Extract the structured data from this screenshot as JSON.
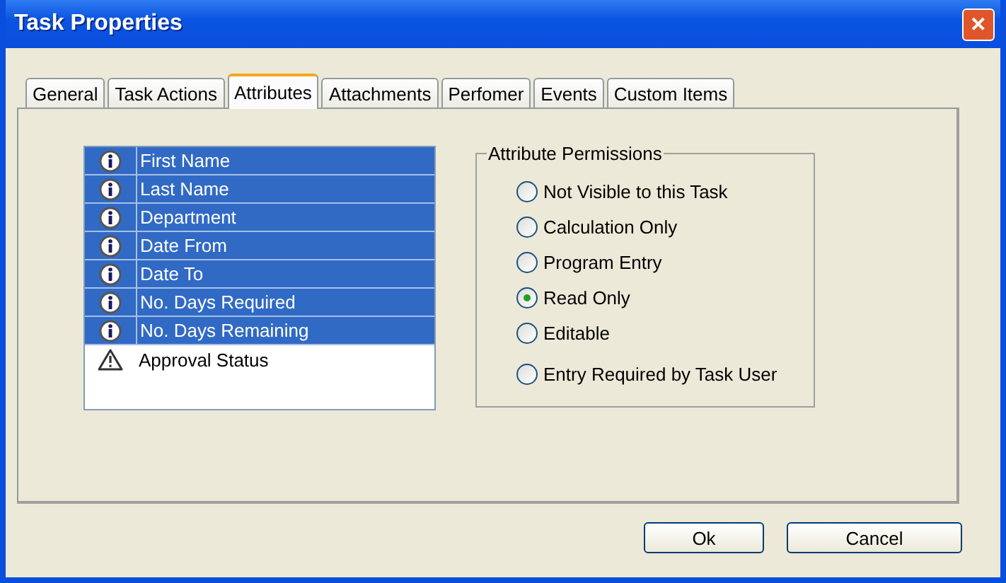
{
  "window": {
    "title": "Task Properties",
    "close": "✕"
  },
  "tabs": [
    {
      "label": "General",
      "selected": false
    },
    {
      "label": "Task Actions",
      "selected": false
    },
    {
      "label": "Attributes",
      "selected": true
    },
    {
      "label": "Attachments",
      "selected": false
    },
    {
      "label": "Perfomer",
      "selected": false
    },
    {
      "label": "Events",
      "selected": false
    },
    {
      "label": "Custom Items",
      "selected": false
    }
  ],
  "attributes": [
    {
      "label": "First Name",
      "kind": "info",
      "selected": true
    },
    {
      "label": "Last Name",
      "kind": "info",
      "selected": true
    },
    {
      "label": "Department",
      "kind": "info",
      "selected": true
    },
    {
      "label": "Date From",
      "kind": "info",
      "selected": true
    },
    {
      "label": "Date To",
      "kind": "info",
      "selected": true
    },
    {
      "label": "No. Days Required",
      "kind": "info",
      "selected": true
    },
    {
      "label": "No. Days Remaining",
      "kind": "info",
      "selected": true
    },
    {
      "label": "Approval Status",
      "kind": "warning",
      "selected": false
    }
  ],
  "permissions": {
    "title": "Attribute Permissions",
    "options": [
      {
        "label": "Not Visible to this Task",
        "selected": false
      },
      {
        "label": "Calculation Only",
        "selected": false
      },
      {
        "label": "Program Entry",
        "selected": false
      },
      {
        "label": "Read Only",
        "selected": true
      },
      {
        "label": "Editable",
        "selected": false
      },
      {
        "label": "Entry Required by Task User",
        "selected": false
      }
    ]
  },
  "buttons": [
    "Ok",
    "Cancel"
  ]
}
